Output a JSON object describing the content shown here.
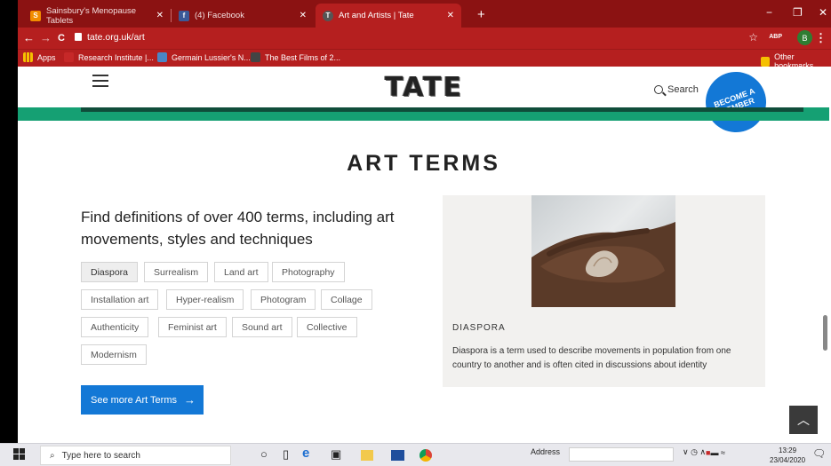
{
  "browser": {
    "tabs": [
      {
        "title": "Sainsbury's Menopause Tablets",
        "favicon": "S",
        "favicon_color": "#f28c00"
      },
      {
        "title": "(4) Facebook",
        "favicon": "f",
        "favicon_color": "#3b5998"
      },
      {
        "title": "Art and Artists | Tate",
        "favicon": "T",
        "favicon_color": "#555555",
        "active": true
      }
    ],
    "new_tab_label": "+",
    "window_controls": {
      "minimize": "−",
      "restore": "❐",
      "close": "✕"
    },
    "address": {
      "url": "tate.org.uk/art"
    },
    "nav": {
      "back": "←",
      "forward": "→",
      "reload": "C"
    },
    "profile_initial": "B",
    "abp_label": "ABP",
    "bookmarks": [
      {
        "label": "Apps",
        "icon": "apps-icon"
      },
      {
        "label": "Research Institute |...",
        "icon": "bookmark-icon"
      },
      {
        "label": "Germain Lussier's N...",
        "icon": "bookmark-icon"
      },
      {
        "label": "The Best Films of 2...",
        "icon": "bookmark-icon"
      }
    ],
    "other_bookmarks": "Other bookmarks"
  },
  "site": {
    "logo": "TATE",
    "search_label": "Search",
    "member_button": "BECOME A MEMBER",
    "accent_color": "#15a073",
    "brand_blue": "#1378d6"
  },
  "main": {
    "title": "ART TERMS",
    "intro": "Find definitions of over 400 terms, including art movements, styles and techniques",
    "terms": [
      {
        "label": "Diaspora",
        "selected": true
      },
      {
        "label": "Surrealism"
      },
      {
        "label": "Land art"
      },
      {
        "label": "Photography"
      },
      {
        "label": "Installation art"
      },
      {
        "label": "Hyper-realism"
      },
      {
        "label": "Photogram"
      },
      {
        "label": "Collage"
      },
      {
        "label": "Authenticity"
      },
      {
        "label": "Feminist art"
      },
      {
        "label": "Sound art"
      },
      {
        "label": "Collective"
      },
      {
        "label": "Modernism"
      }
    ],
    "cta_label": "See more Art Terms",
    "card": {
      "caption": "DIASPORA",
      "description": "Diaspora is a term used to describe movements in population from one country to another and is often cited in discussions about identity"
    }
  },
  "taskbar": {
    "search_placeholder": "Type here to search",
    "address_label": "Address",
    "time": "13:29",
    "date": "23/04/2020"
  }
}
